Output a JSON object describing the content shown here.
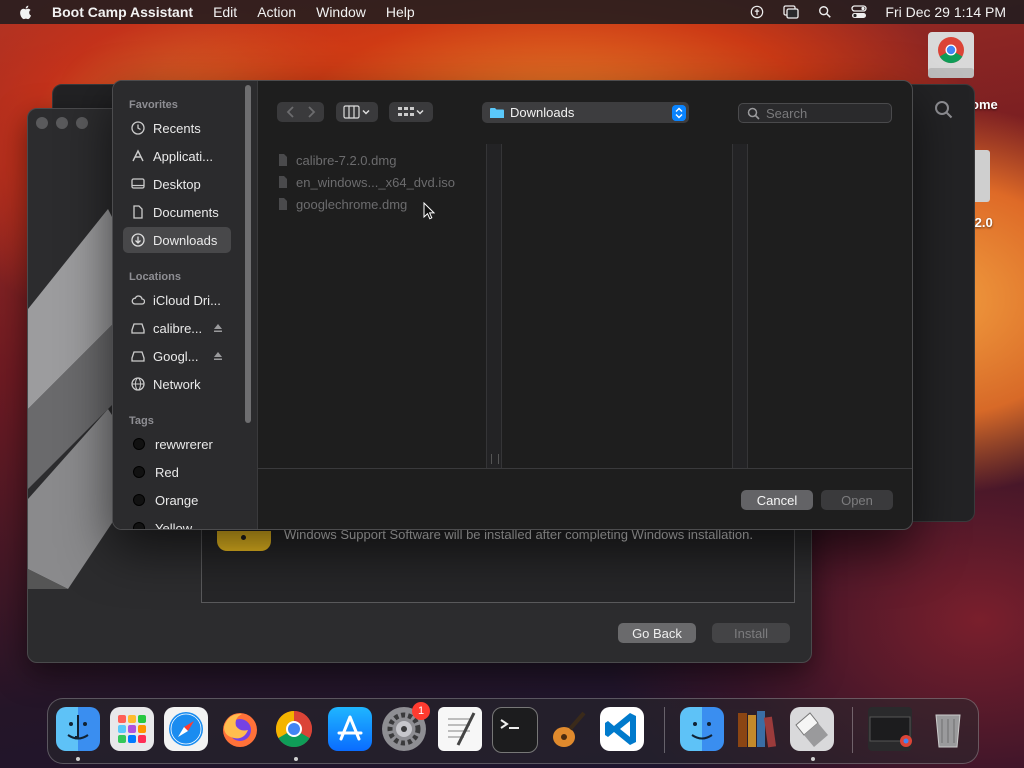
{
  "menubar": {
    "app_name": "Boot Camp Assistant",
    "menus": [
      "Edit",
      "Action",
      "Window",
      "Help"
    ],
    "datetime": "Fri Dec 29  1:14 PM"
  },
  "desktop": {
    "icon1_label": "ome",
    "icon2_label": ".2.0"
  },
  "bootcamp": {
    "support_text": "Windows Support Software will be installed after completing Windows installation.",
    "go_back_label": "Go Back",
    "install_label": "Install"
  },
  "dialog": {
    "sidebar": {
      "favorites_heading": "Favorites",
      "favorites": [
        "Recents",
        "Applicati...",
        "Desktop",
        "Documents",
        "Downloads"
      ],
      "selected": "Downloads",
      "locations_heading": "Locations",
      "locations": [
        "iCloud Dri...",
        "calibre...",
        "Googl...",
        "Network"
      ],
      "tags_heading": "Tags",
      "tags": [
        "rewwrerer",
        "Red",
        "Orange",
        "Yellow"
      ]
    },
    "path_label": "Downloads",
    "search_placeholder": "Search",
    "files": [
      "calibre-7.2.0.dmg",
      "en_windows..._x64_dvd.iso",
      "googlechrome.dmg"
    ],
    "cancel_label": "Cancel",
    "open_label": "Open"
  },
  "dock": {
    "apps": [
      "Finder",
      "Launchpad",
      "Safari",
      "Firefox",
      "Google Chrome",
      "App Store",
      "System Settings",
      "TextEdit",
      "Terminal",
      "GarageBand",
      "Visual Studio Code",
      "Finder",
      "calibre",
      "Boot Camp Assistant",
      "Recent Window",
      "Trash"
    ],
    "settings_badge": "1"
  },
  "colors": {
    "accent": "#0a84ff",
    "warning": "#f5c422",
    "badge": "#ff3b30"
  }
}
